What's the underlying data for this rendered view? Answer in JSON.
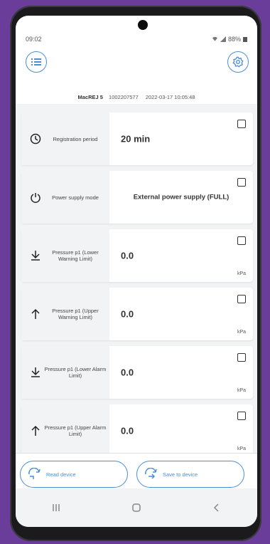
{
  "status": {
    "time": "09:02",
    "battery": "88%"
  },
  "header": {
    "device_name": "MacREJ 5",
    "serial": "1002207577",
    "timestamp": "2022-03-17 10:05:48"
  },
  "rows": [
    {
      "label": "Registration period",
      "value": "20 min",
      "unit": "",
      "icon": "clock-icon"
    },
    {
      "label": "Power supply mode",
      "value": "External power supply (FULL)",
      "unit": "",
      "icon": "power-icon"
    },
    {
      "label": "Pressure p1 (Lower Warning Limit)",
      "value": "0.0",
      "unit": "kPa",
      "icon": "arrow-down-limit-icon"
    },
    {
      "label": "Pressure p1 (Upper Warning Limit)",
      "value": "0.0",
      "unit": "kPa",
      "icon": "arrow-up-icon"
    },
    {
      "label": "Pressure p1 (Lower Alarm Limit)",
      "value": "0.0",
      "unit": "kPa",
      "icon": "arrow-down-limit-icon"
    },
    {
      "label": "Pressure p1 (Upper Alarm Limit)",
      "value": "0.0",
      "unit": "kPa",
      "icon": "arrow-up-icon"
    }
  ],
  "actions": {
    "read_label": "Read device",
    "save_label": "Save to device"
  },
  "colors": {
    "accent": "#4a8fd6",
    "background": "#6a3d9a"
  }
}
